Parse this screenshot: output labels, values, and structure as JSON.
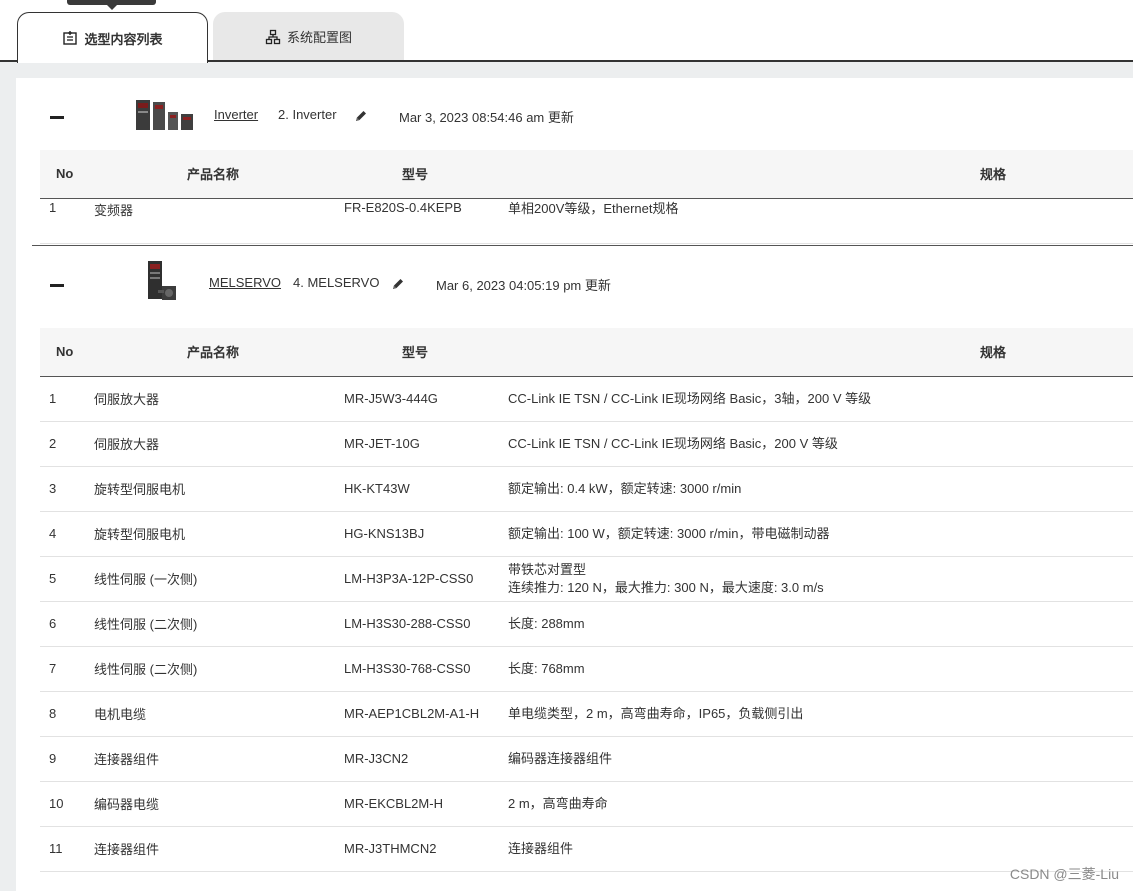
{
  "tabs": [
    {
      "label": "选型内容列表",
      "icon": "list-edit-icon",
      "active": true
    },
    {
      "label": "系统配置图",
      "icon": "network-diagram-icon",
      "active": false
    }
  ],
  "columns": {
    "no": "No",
    "name": "产品名称",
    "model": "型号",
    "spec": "规格"
  },
  "sections": [
    {
      "link": "Inverter",
      "label": "2. Inverter",
      "updated": "Mar 3, 2023 08:54:46 am 更新",
      "rows": [
        {
          "no": "1",
          "name": "变频器",
          "model": "FR-E820S-0.4KEPB",
          "spec": "单相200V等级，Ethernet规格"
        }
      ]
    },
    {
      "link": "MELSERVO",
      "label": "4. MELSERVO",
      "updated": "Mar 6, 2023 04:05:19 pm 更新",
      "rows": [
        {
          "no": "1",
          "name": "伺服放大器",
          "model": "MR-J5W3-444G",
          "spec": "CC-Link IE TSN / CC-Link IE现场网络 Basic，3轴，200 V 等级"
        },
        {
          "no": "2",
          "name": "伺服放大器",
          "model": "MR-JET-10G",
          "spec": "CC-Link IE TSN / CC-Link IE现场网络 Basic，200 V 等级"
        },
        {
          "no": "3",
          "name": "旋转型伺服电机",
          "model": "HK-KT43W",
          "spec": "额定输出: 0.4 kW，额定转速: 3000 r/min"
        },
        {
          "no": "4",
          "name": "旋转型伺服电机",
          "model": "HG-KNS13BJ",
          "spec": "额定输出: 100 W，额定转速: 3000 r/min，带电磁制动器"
        },
        {
          "no": "5",
          "name": "线性伺服 (一次侧)",
          "model": "LM-H3P3A-12P-CSS0",
          "spec": "带铁芯对置型",
          "spec2": "连续推力: 120 N，最大推力: 300 N，最大速度: 3.0 m/s"
        },
        {
          "no": "6",
          "name": "线性伺服 (二次侧)",
          "model": "LM-H3S30-288-CSS0",
          "spec": "长度: 288mm"
        },
        {
          "no": "7",
          "name": "线性伺服 (二次侧)",
          "model": "LM-H3S30-768-CSS0",
          "spec": "长度: 768mm"
        },
        {
          "no": "8",
          "name": "电机电缆",
          "model": "MR-AEP1CBL2M-A1-H",
          "spec": "单电缆类型，2 m，高弯曲寿命，IP65，负载侧引出"
        },
        {
          "no": "9",
          "name": "连接器组件",
          "model": "MR-J3CN2",
          "spec": "编码器连接器组件"
        },
        {
          "no": "10",
          "name": "编码器电缆",
          "model": "MR-EKCBL2M-H",
          "spec": "2 m，高弯曲寿命"
        },
        {
          "no": "11",
          "name": "连接器组件",
          "model": "MR-J3THMCN2",
          "spec": "连接器组件"
        }
      ]
    }
  ],
  "watermark": "CSDN @三菱-Liu"
}
